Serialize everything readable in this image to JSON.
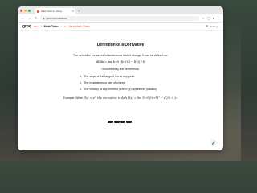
{
  "window": {
    "tab_title": "Math Tutor by Groq",
    "url": "groq.com/mathtutor",
    "traffic_colors": [
      "#ff5f57",
      "#febc2e",
      "#28c840"
    ],
    "accent": "#f55036"
  },
  "app": {
    "logo": "groq",
    "logo_suffix": "labs",
    "breadcrumb_user": "Math Tutor",
    "breadcrumb_chat": "View Math Chats",
    "settings_label": "Settings"
  },
  "doc": {
    "title": "Definition of a Derivative",
    "intro": "The derivative measures instantaneous rate of change. It can be defined as:",
    "formula": "df/dx = lim h→0 (f(x+h) − f(x)) / h",
    "geometric": "Geometrically, this represents:",
    "bullets": [
      "The slope of the tangent line at any point",
      "The instantaneous rate of change",
      "The velocity at any moment (when f(x) represents position)"
    ],
    "example_prefix": "Example: When",
    "example_math": "f(x) = x², the derivative is d/dx f(x) = lim h→0 ((x+h)² − x²)/h = 2x"
  },
  "icons": {
    "back": "back-arrow-icon",
    "forward": "forward-arrow-icon",
    "reload": "reload-icon",
    "settings": "gear-icon",
    "mic": "microphone-icon"
  }
}
